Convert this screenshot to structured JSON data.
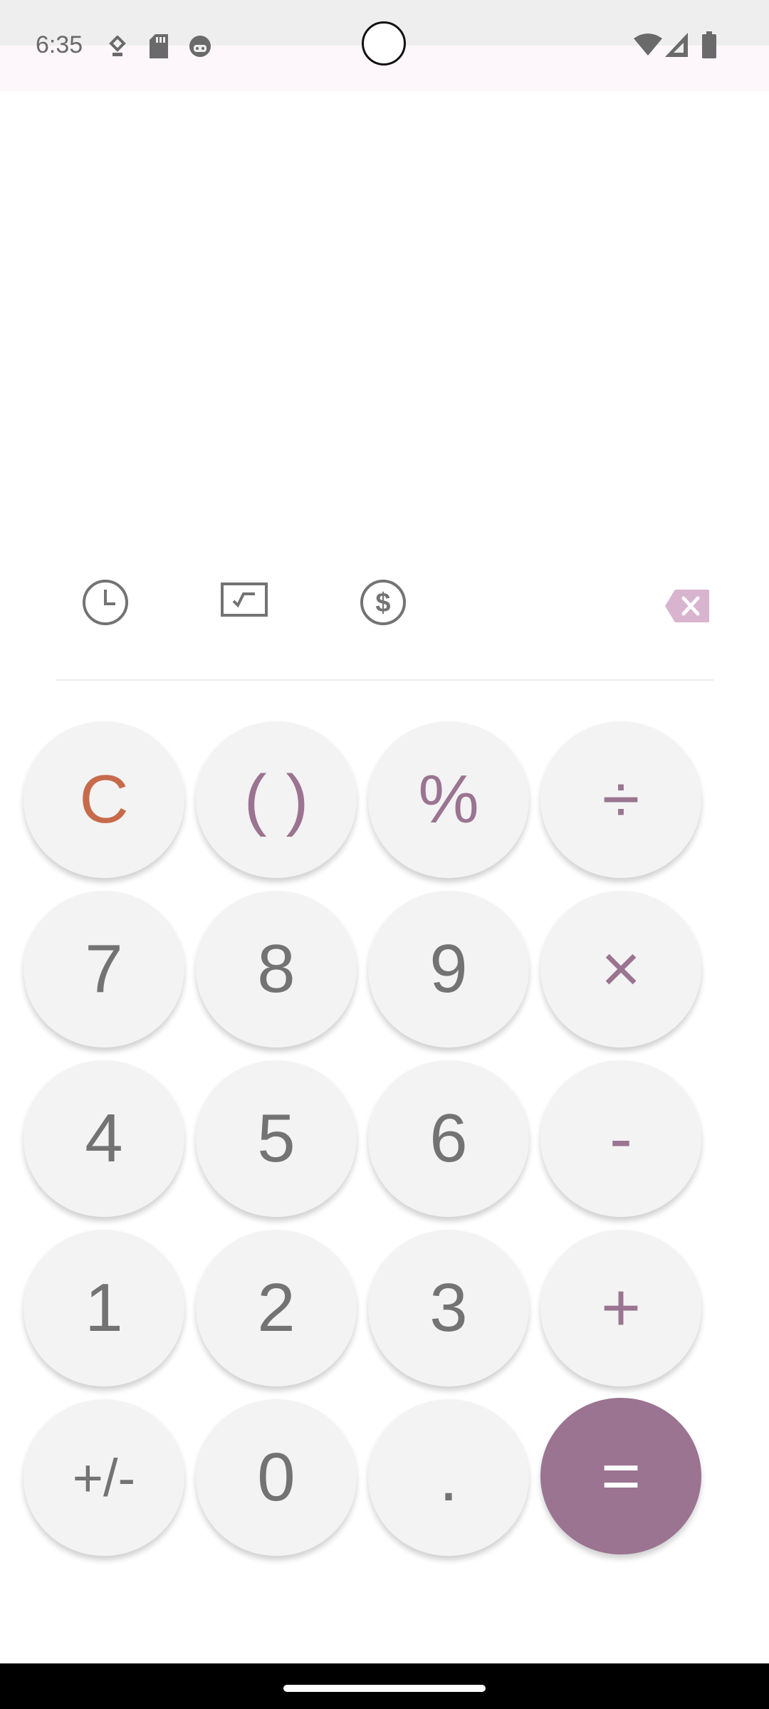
{
  "status_bar": {
    "time": "6:35",
    "left_icons": [
      "location-pin-icon",
      "sd-card-icon",
      "android-face-icon"
    ],
    "right_icons": [
      "wifi-icon",
      "cell-signal-icon",
      "battery-icon"
    ]
  },
  "display": {
    "expression": "",
    "result": ""
  },
  "toolbar": {
    "history_icon": "clock-icon",
    "scientific_icon": "sqrt-board-icon",
    "currency_icon": "dollar-circle-icon",
    "backspace_icon": "backspace-icon"
  },
  "colors": {
    "accent": "#9a7490",
    "clear": "#c76a4c",
    "key_bg": "#f3f3f3",
    "digit_text": "#737373",
    "backspace_bg": "#d8b4cf"
  },
  "keypad": {
    "row1": [
      "C",
      "( )",
      "%",
      "÷"
    ],
    "row2": [
      "7",
      "8",
      "9",
      "×"
    ],
    "row3": [
      "4",
      "5",
      "6",
      "-"
    ],
    "row4": [
      "1",
      "2",
      "3",
      "+"
    ],
    "row5": [
      "+/-",
      "0",
      ".",
      "="
    ]
  }
}
